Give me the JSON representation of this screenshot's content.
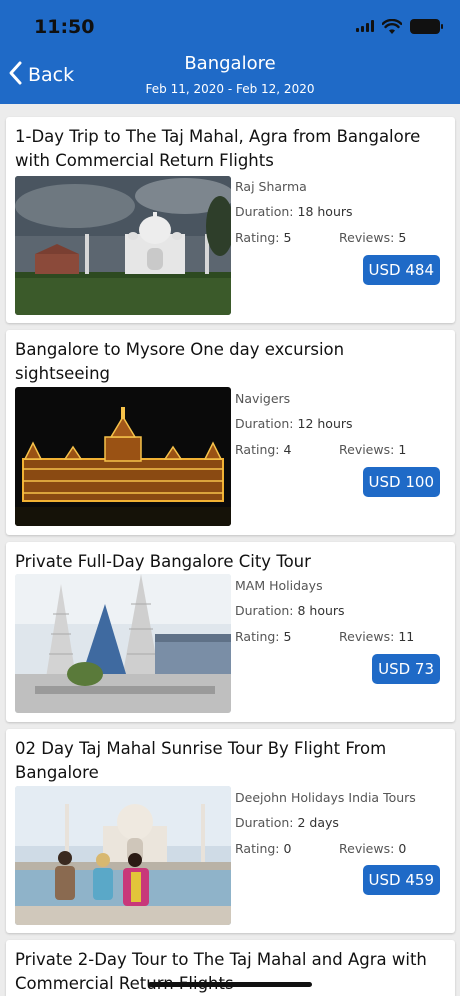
{
  "status": {
    "time": "11:50"
  },
  "nav": {
    "back_label": "Back",
    "title": "Bangalore",
    "subtitle": "Feb 11, 2020 - Feb 12, 2020"
  },
  "labels": {
    "duration": "Duration:",
    "rating": "Rating:",
    "reviews": "Reviews:"
  },
  "tours": [
    {
      "title": "1-Day Trip to The Taj Mahal, Agra from Bangalore with Commercial Return Flights",
      "provider": "Raj Sharma",
      "duration": "18 hours",
      "rating": "5",
      "reviews": "5",
      "price": "USD 484"
    },
    {
      "title": "Bangalore to Mysore One day excursion sightseeing",
      "provider": "Navigers",
      "duration": "12 hours",
      "rating": "4",
      "reviews": "1",
      "price": "USD 100"
    },
    {
      "title": "Private Full-Day Bangalore City Tour",
      "provider": "MAM Holidays",
      "duration": "8 hours",
      "rating": "5",
      "reviews": "11",
      "price": "USD 73"
    },
    {
      "title": "02 Day Taj Mahal Sunrise Tour By Flight From Bangalore",
      "provider": "Deejohn Holidays India Tours",
      "duration": "2 days",
      "rating": "0",
      "reviews": "0",
      "price": "USD 459"
    },
    {
      "title": "Private 2-Day Tour to The Taj Mahal and Agra with Commercial Return Flights"
    }
  ]
}
